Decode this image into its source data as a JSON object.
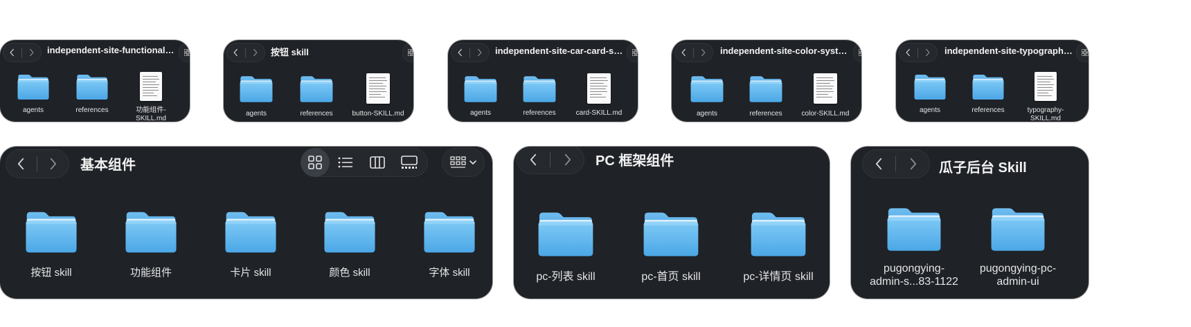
{
  "colors": {
    "window_bg": "#1f2227",
    "folder_light": "#7cc6f5",
    "folder_dark": "#4aa9e8",
    "text": "#e6e6e6"
  },
  "icons": {
    "back": "chevron-left-icon",
    "forward": "chevron-right-icon",
    "folder": "folder-icon",
    "file": "document-icon"
  },
  "windows": [
    {
      "title": "independent-site-functional-co...",
      "items": [
        "agents",
        "references",
        "功能组件-SKILL.md"
      ]
    },
    {
      "title": "按钮 skill",
      "items": [
        "agents",
        "references",
        "button-SKILL.md"
      ]
    },
    {
      "title": "independent-site-car-card-spec",
      "items": [
        "agents",
        "references",
        "card-SKILL.md"
      ]
    },
    {
      "title": "independent-site-color-system...",
      "items": [
        "agents",
        "references",
        "color-SKILL.md"
      ]
    },
    {
      "title": "independent-site-typography-s...",
      "items": [
        "agents",
        "references",
        "typography-SKILL.md"
      ]
    },
    {
      "title": "基本组件",
      "items": [
        "按钮 skill",
        "功能组件",
        "卡片 skill",
        "颜色 skill",
        "字体 skill"
      ]
    },
    {
      "title": "PC 框架组件",
      "items": [
        "pc-列表 skill",
        "pc-首页 skill",
        "pc-详情页 skill"
      ]
    },
    {
      "title": "瓜子后台 Skill",
      "items": [
        "pugongying-admin-s...83-1122",
        "pugongying-pc-admin-ui"
      ]
    }
  ]
}
